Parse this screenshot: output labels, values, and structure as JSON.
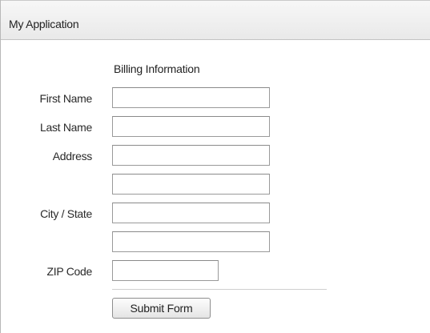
{
  "app": {
    "title": "My Application"
  },
  "form": {
    "heading": "Billing Information",
    "labels": {
      "first_name": "First Name",
      "last_name": "Last Name",
      "address": "Address",
      "city_state": "City / State",
      "zip": "ZIP Code"
    },
    "values": {
      "first_name": "",
      "last_name": "",
      "address_line1": "",
      "address_line2": "",
      "city": "",
      "state": "",
      "zip": ""
    },
    "submit_label": "Submit Form"
  }
}
